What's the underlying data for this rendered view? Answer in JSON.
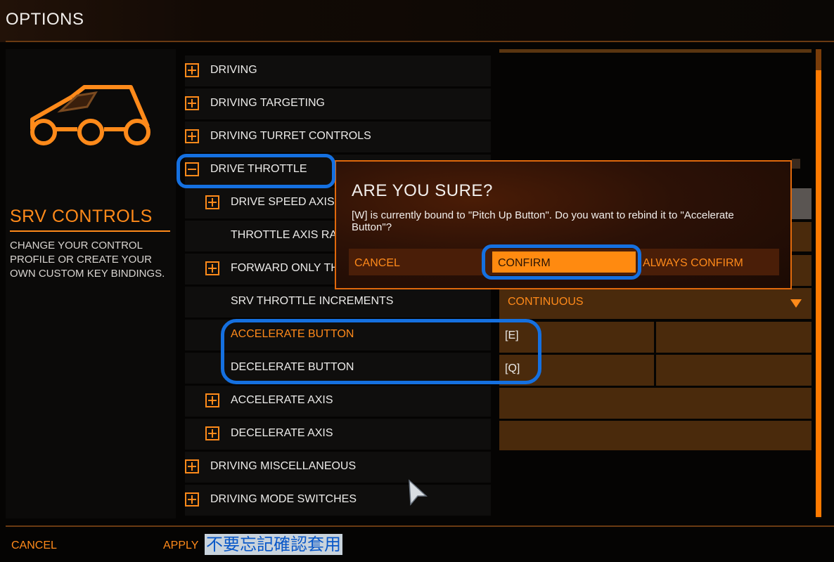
{
  "header": {
    "title": "OPTIONS"
  },
  "left_panel": {
    "icon": "srv-buggy-icon",
    "title": "SRV CONTROLS",
    "description": "CHANGE YOUR CONTROL PROFILE OR CREATE YOUR OWN CUSTOM KEY BINDINGS."
  },
  "list": {
    "items": [
      {
        "label": "DRIVING",
        "expand": "plus"
      },
      {
        "label": "DRIVING TARGETING",
        "expand": "plus"
      },
      {
        "label": "DRIVING TURRET CONTROLS",
        "expand": "plus"
      },
      {
        "label": "DRIVE THROTTLE",
        "expand": "minus"
      },
      {
        "label": "DRIVE SPEED AXIS",
        "expand": "plus"
      },
      {
        "label": "THROTTLE AXIS RANGE",
        "expand": "none"
      },
      {
        "label": "FORWARD ONLY THROTTLE",
        "expand": "plus"
      },
      {
        "label": "SRV THROTTLE INCREMENTS",
        "expand": "none"
      },
      {
        "label": "ACCELERATE BUTTON",
        "expand": "none",
        "selected": true
      },
      {
        "label": "DECELERATE BUTTON",
        "expand": "none"
      },
      {
        "label": "ACCELERATE AXIS",
        "expand": "plus"
      },
      {
        "label": "DECELERATE AXIS",
        "expand": "plus"
      },
      {
        "label": "DRIVING MISCELLANEOUS",
        "expand": "plus"
      },
      {
        "label": "DRIVING MODE SWITCHES",
        "expand": "plus"
      }
    ]
  },
  "values": {
    "throttle_increments": "CONTINUOUS",
    "accelerate_primary": "[E]",
    "decelerate_primary": "[Q]"
  },
  "dialog": {
    "title": "ARE YOU SURE?",
    "message": "[W] is currently bound to \"Pitch Up Button\". Do you want to rebind it to \"Accelerate Button\"?",
    "cancel": "CANCEL",
    "confirm": "CONFIRM",
    "always_confirm": "ALWAYS CONFIRM"
  },
  "footer": {
    "cancel": "CANCEL",
    "apply": "APPLY",
    "note": "不要忘記確認套用"
  },
  "colors": {
    "accent": "#ff8a1a",
    "annotation": "#1570e0",
    "background": "#050403"
  }
}
